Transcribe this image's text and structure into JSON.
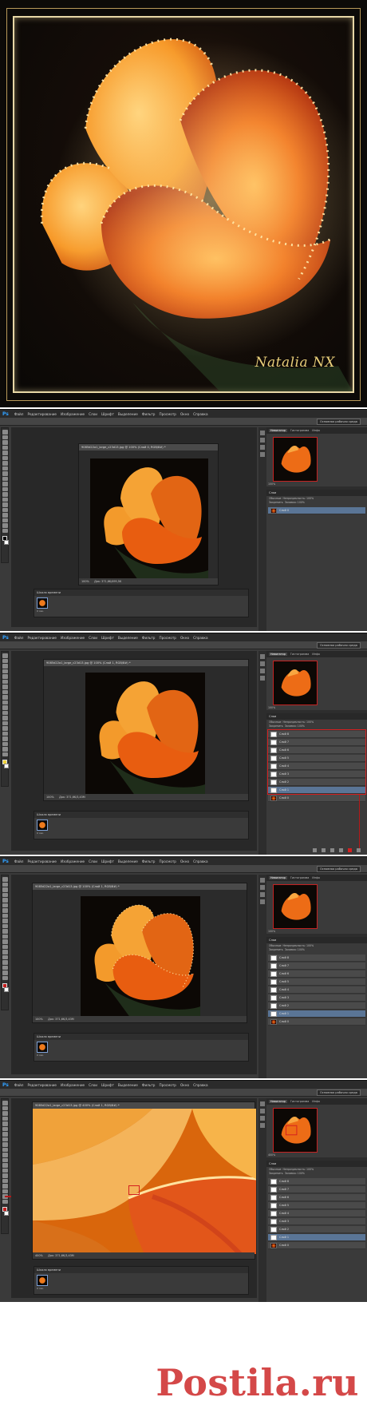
{
  "hero": {
    "signature": "Natalia NX"
  },
  "photoshop": {
    "logo": "Ps",
    "menu": [
      "Файл",
      "Редактирование",
      "Изображение",
      "Слои",
      "Шрифт",
      "Выделение",
      "Фильтр",
      "Просмотр",
      "Окно",
      "Справка"
    ],
    "essentials_label": "Основная рабочая среда",
    "panel_tabs": [
      "Навигатор",
      "Гистограмма",
      "Инфо"
    ],
    "layers_tabs": [
      "Слои",
      "Каналы",
      "Контуры"
    ],
    "layers_opts": [
      "Вид",
      "Обычные",
      "Непрозрачность: 100%",
      "Закрепить",
      "Заливка: 100%"
    ],
    "animation_title": "Шкала времени",
    "frame_delay": "0 сек."
  },
  "screens": [
    {
      "doc_title": "9085d22a1_large_c23d13.jpg @ 100% (Слой 0, RGB/8#) *",
      "zoom": "100%",
      "status": "Док: 371,6K/495,5K",
      "nav_zoom": "100%",
      "layers": [
        "Слой 0"
      ]
    },
    {
      "doc_title": "9085d22a1_large_c23d13.jpg @ 100% (Слой 1, RGB/8#) *",
      "zoom": "100%",
      "status": "Док: 371,6K/3,43M",
      "nav_zoom": "100%",
      "layers": [
        "Слой 8",
        "Слой 7",
        "Слой 6",
        "Слой 5",
        "Слой 4",
        "Слой 3",
        "Слой 2",
        "Слой 1",
        "Слой 0"
      ]
    },
    {
      "doc_title": "9085d22a1_large_c23d13.jpg @ 100% (Слой 1, RGB/8#) *",
      "zoom": "100%",
      "status": "Док: 371,6K/3,43M",
      "nav_zoom": "100%",
      "layers": [
        "Слой 8",
        "Слой 7",
        "Слой 6",
        "Слой 5",
        "Слой 4",
        "Слой 3",
        "Слой 2",
        "Слой 1",
        "Слой 0"
      ]
    },
    {
      "doc_title": "9085d22a1_large_c23d13.jpg @ 400% (Слой 1, RGB/8#) *",
      "zoom": "400%",
      "status": "Док: 371,6K/3,43M",
      "nav_zoom": "400%",
      "layers": [
        "Слой 8",
        "Слой 7",
        "Слой 6",
        "Слой 5",
        "Слой 4",
        "Слой 3",
        "Слой 2",
        "Слой 1",
        "Слой 0"
      ]
    }
  ],
  "watermark": "Postila.ru",
  "colors": {
    "ps_bg": "#3a3a3a",
    "accent_red": "#d42020",
    "selection_blue": "#5a7596",
    "signature_gold": "#e9cf7a"
  }
}
